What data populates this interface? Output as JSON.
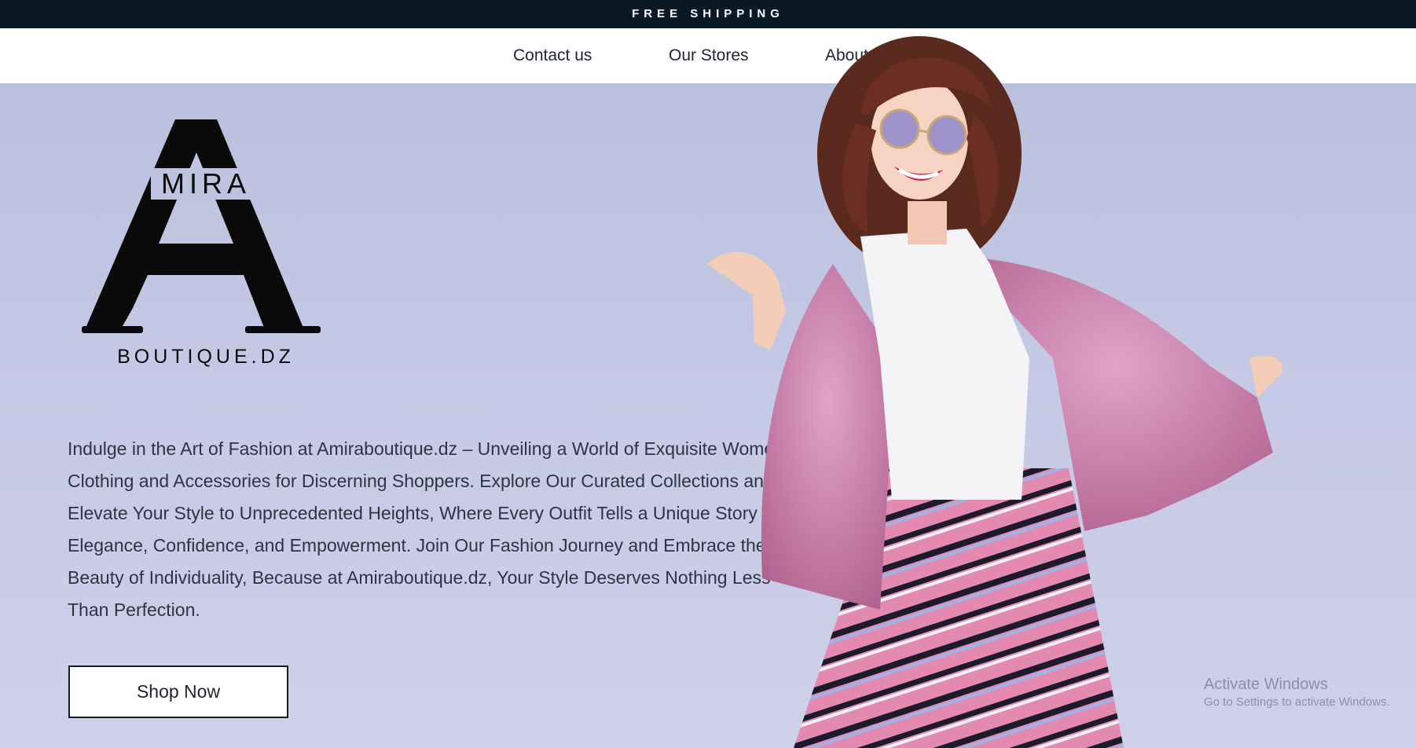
{
  "topbar": {
    "text": "FREE SHIPPING"
  },
  "nav": {
    "items": [
      {
        "label": "Contact us"
      },
      {
        "label": "Our Stores"
      },
      {
        "label": "About us"
      }
    ]
  },
  "logo": {
    "top_text": "MIRA",
    "bottom_text": "BOUTIQUE.DZ"
  },
  "hero": {
    "description": "Indulge in the Art of Fashion at Amiraboutique.dz – Unveiling a World of Exquisite Women's Clothing and Accessories for Discerning Shoppers. Explore Our Curated Collections and Elevate Your Style to Unprecedented Heights, Where Every Outfit Tells a Unique Story of Elegance, Confidence, and Empowerment. Join Our Fashion Journey and Embrace the Beauty of Individuality, Because at Amiraboutique.dz, Your Style Deserves Nothing Less Than Perfection.",
    "cta_label": "Shop Now"
  },
  "watermark": {
    "line1": "Activate Windows",
    "line2": "Go to Settings to activate Windows."
  },
  "colors": {
    "topbar_bg": "#0a1a24",
    "hero_bg": "#c6c9e5",
    "jacket": "#c77aa8",
    "stripes_pink": "#e48ab0"
  }
}
